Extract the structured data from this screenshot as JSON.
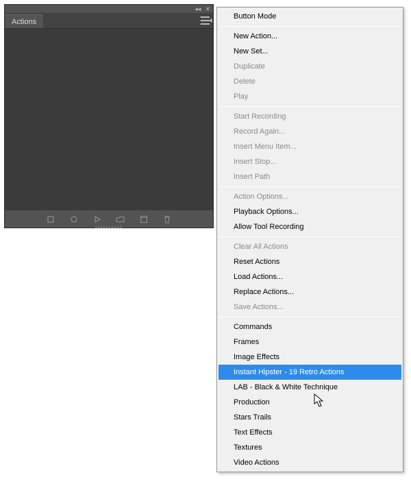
{
  "panel": {
    "tab_label": "Actions",
    "footer_icons": [
      "stop-icon",
      "record-icon",
      "play-icon",
      "folder-icon",
      "new-icon",
      "trash-icon"
    ]
  },
  "menu": {
    "groups": [
      [
        {
          "label": "Button Mode",
          "disabled": false
        }
      ],
      [
        {
          "label": "New Action...",
          "disabled": false
        },
        {
          "label": "New Set...",
          "disabled": false
        },
        {
          "label": "Duplicate",
          "disabled": true
        },
        {
          "label": "Delete",
          "disabled": true
        },
        {
          "label": "Play",
          "disabled": true
        }
      ],
      [
        {
          "label": "Start Recording",
          "disabled": true
        },
        {
          "label": "Record Again...",
          "disabled": true
        },
        {
          "label": "Insert Menu Item...",
          "disabled": true
        },
        {
          "label": "Insert Stop...",
          "disabled": true
        },
        {
          "label": "Insert Path",
          "disabled": true
        }
      ],
      [
        {
          "label": "Action Options...",
          "disabled": true
        },
        {
          "label": "Playback Options...",
          "disabled": false
        },
        {
          "label": "Allow Tool Recording",
          "disabled": false
        }
      ],
      [
        {
          "label": "Clear All Actions",
          "disabled": true
        },
        {
          "label": "Reset Actions",
          "disabled": false
        },
        {
          "label": "Load Actions...",
          "disabled": false
        },
        {
          "label": "Replace Actions...",
          "disabled": false
        },
        {
          "label": "Save Actions...",
          "disabled": true
        }
      ],
      [
        {
          "label": "Commands",
          "disabled": false
        },
        {
          "label": "Frames",
          "disabled": false
        },
        {
          "label": "Image Effects",
          "disabled": false
        },
        {
          "label": "Instant Hipster - 19 Retro Actions",
          "disabled": false,
          "highlighted": true
        },
        {
          "label": "LAB - Black & White Technique",
          "disabled": false
        },
        {
          "label": "Production",
          "disabled": false
        },
        {
          "label": "Stars Trails",
          "disabled": false
        },
        {
          "label": "Text Effects",
          "disabled": false
        },
        {
          "label": "Textures",
          "disabled": false
        },
        {
          "label": "Video Actions",
          "disabled": false
        }
      ]
    ]
  }
}
